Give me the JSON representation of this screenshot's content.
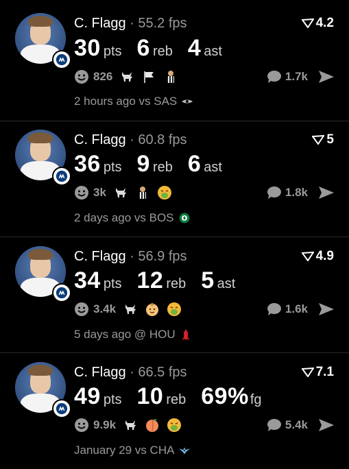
{
  "posts": [
    {
      "player": "C. Flagg",
      "fps": "· 55.2 fps",
      "rating": "4.2",
      "stats": [
        {
          "value": "30",
          "unit": "pts"
        },
        {
          "value": "6",
          "unit": "reb"
        },
        {
          "value": "4",
          "unit": "ast"
        }
      ],
      "reactions_count": "826",
      "reaction_icons": [
        "goat-icon",
        "flag-icon",
        "referee-icon"
      ],
      "comments": "1.7k",
      "time": "2 hours ago vs SAS",
      "opponent_icon": "spurs-logo-icon"
    },
    {
      "player": "C. Flagg",
      "fps": "· 60.8 fps",
      "rating": "5",
      "stats": [
        {
          "value": "36",
          "unit": "pts"
        },
        {
          "value": "9",
          "unit": "reb"
        },
        {
          "value": "6",
          "unit": "ast"
        }
      ],
      "reactions_count": "3k",
      "reaction_icons": [
        "goat-icon",
        "referee-icon",
        "sick-face-icon"
      ],
      "comments": "1.8k",
      "time": "2 days ago vs BOS",
      "opponent_icon": "celtics-logo-icon"
    },
    {
      "player": "C. Flagg",
      "fps": "· 56.9 fps",
      "rating": "4.9",
      "stats": [
        {
          "value": "34",
          "unit": "pts"
        },
        {
          "value": "12",
          "unit": "reb"
        },
        {
          "value": "5",
          "unit": "ast"
        }
      ],
      "reactions_count": "3.4k",
      "reaction_icons": [
        "goat-icon",
        "baby-icon",
        "sick-face-icon"
      ],
      "comments": "1.6k",
      "time": "5 days ago @ HOU",
      "opponent_icon": "rockets-logo-icon"
    },
    {
      "player": "C. Flagg",
      "fps": "· 66.5 fps",
      "rating": "7.1",
      "stats": [
        {
          "value": "49",
          "unit": "pts"
        },
        {
          "value": "10",
          "unit": "reb"
        },
        {
          "value": "69%",
          "unit": "fg"
        }
      ],
      "reactions_count": "9.9k",
      "reaction_icons": [
        "goat-icon",
        "peach-icon",
        "sick-face-icon"
      ],
      "comments": "5.4k",
      "time": "January 29 vs CHA",
      "opponent_icon": "hornets-logo-icon"
    }
  ],
  "colors": {
    "background": "#000000",
    "text_primary": "#ffffff",
    "text_secondary": "#9a9a9a",
    "divider": "#2a2a2a"
  }
}
